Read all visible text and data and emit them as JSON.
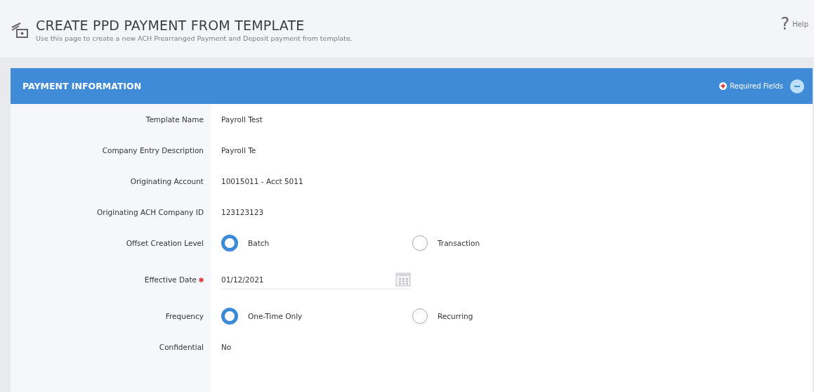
{
  "page": {
    "title": "CREATE PPD PAYMENT FROM TEMPLATE",
    "subtitle": "Use this page to create a new ACH Prearranged Payment and Deposit payment from template.",
    "help_icon": "?",
    "help": "Help"
  },
  "panel": {
    "title": "PAYMENT INFORMATION",
    "required_note": "Required Fields",
    "expanded": true,
    "rows": [
      {
        "kind": "text",
        "label": "Template Name",
        "value": "Payroll Test"
      },
      {
        "kind": "text",
        "label": "Company Entry Description",
        "value": "Payroll Te"
      },
      {
        "kind": "text",
        "label": "Originating Account",
        "value": "10015011 - Acct 5011"
      },
      {
        "kind": "text",
        "label": "Originating ACH Company ID",
        "value": "123123123"
      },
      {
        "kind": "radio",
        "label": "Offset Creation Level",
        "options": [
          {
            "label": "Batch",
            "selected": true
          },
          {
            "label": "Transaction",
            "selected": false
          }
        ]
      },
      {
        "kind": "date",
        "label": "Effective Date",
        "required": true,
        "value": "01/12/2021"
      },
      {
        "kind": "radio",
        "label": "Frequency",
        "options": [
          {
            "label": "One-Time Only",
            "selected": true
          },
          {
            "label": "Recurring",
            "selected": false
          }
        ]
      },
      {
        "kind": "text",
        "label": "Confidential",
        "value": "No"
      }
    ]
  }
}
